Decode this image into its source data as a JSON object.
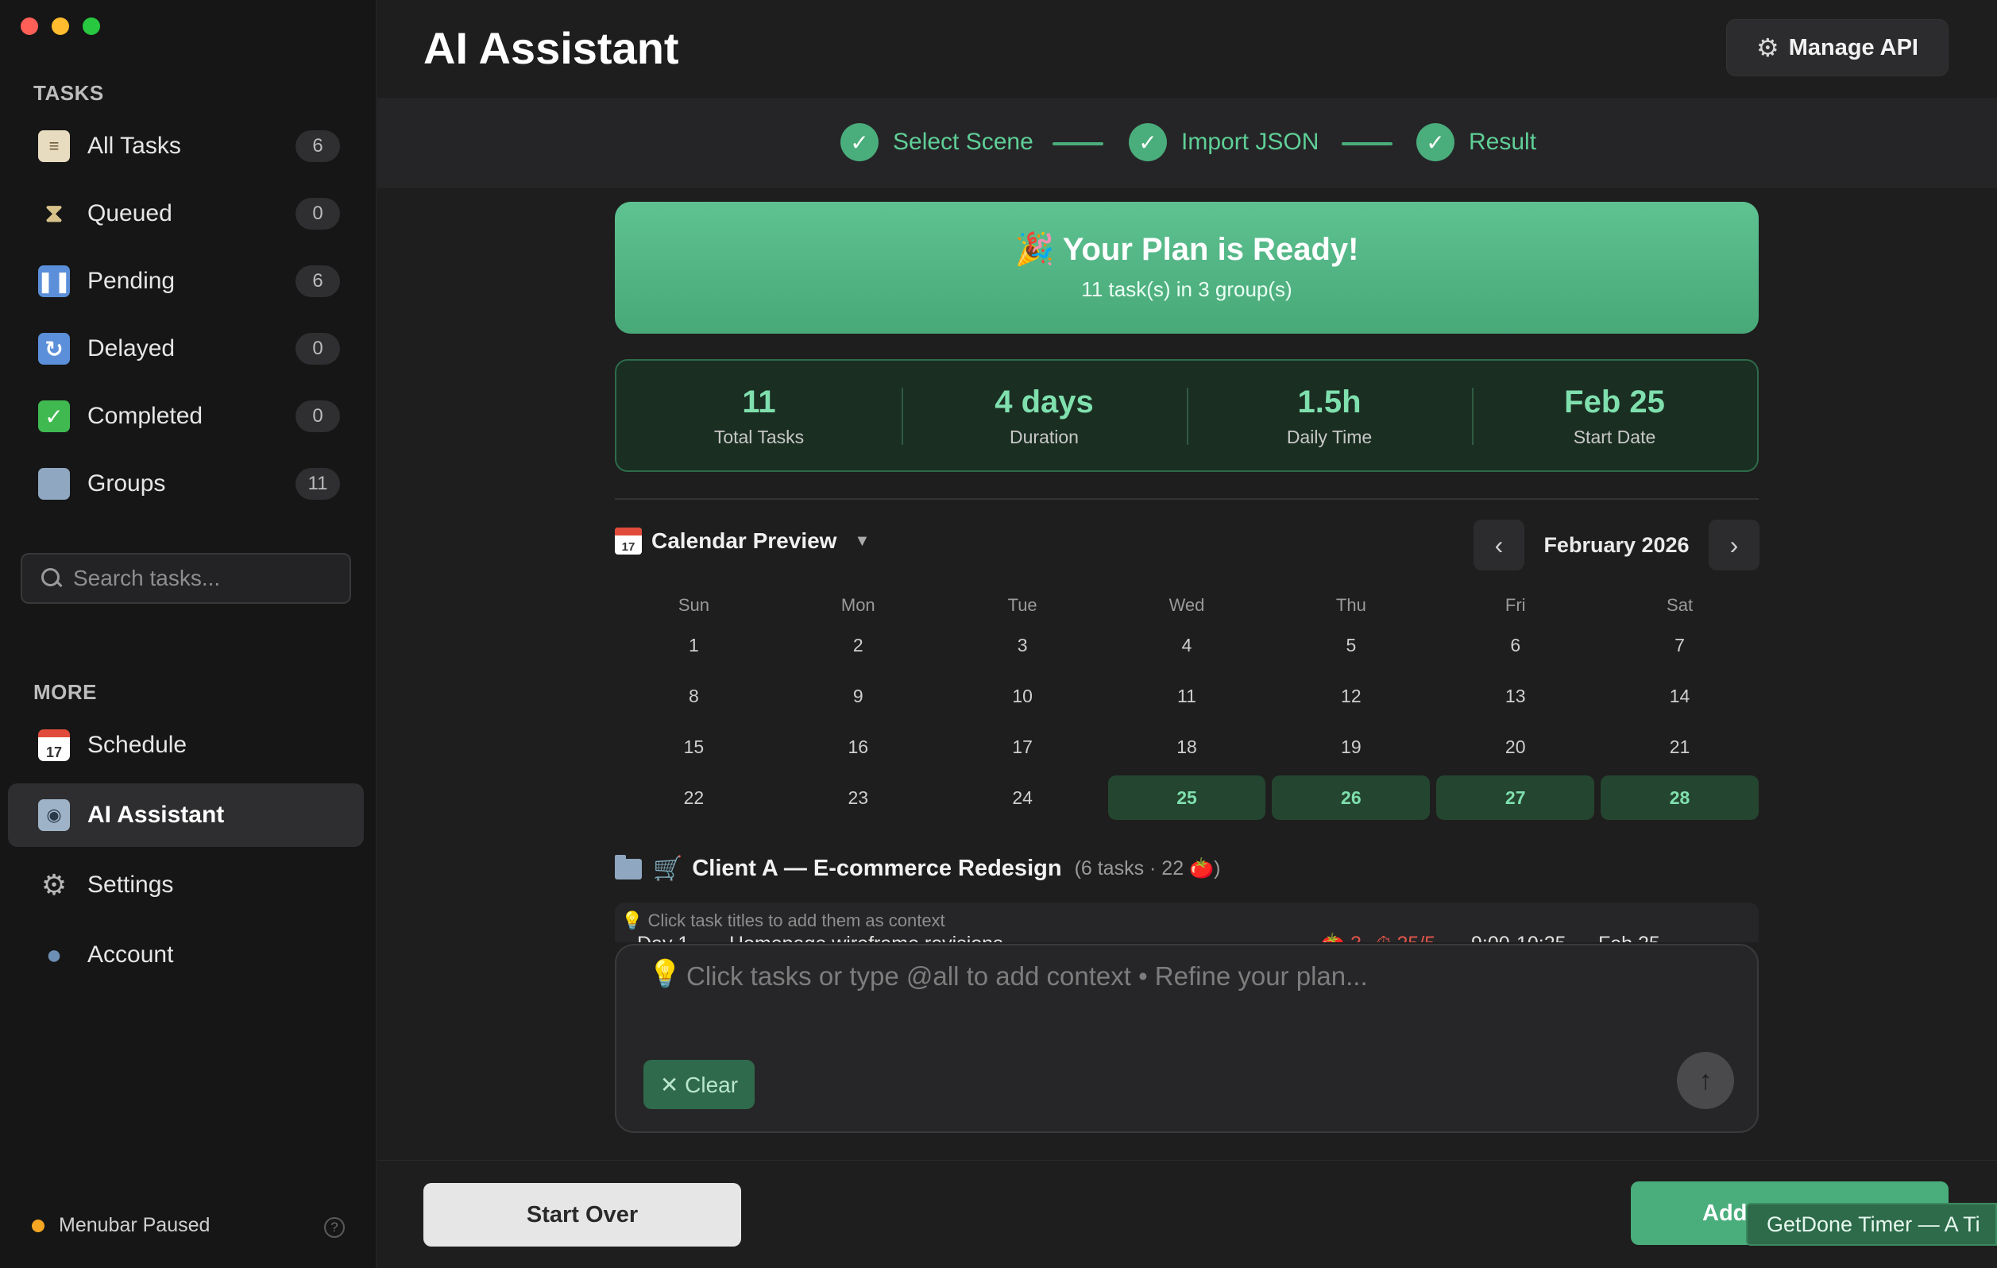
{
  "sidebar": {
    "tasks_label": "TASKS",
    "items": [
      {
        "label": "All Tasks",
        "count": "6",
        "icon": "clipboard-icon"
      },
      {
        "label": "Queued",
        "count": "0",
        "icon": "hourglass-icon"
      },
      {
        "label": "Pending",
        "count": "6",
        "icon": "pause-icon"
      },
      {
        "label": "Delayed",
        "count": "0",
        "icon": "refresh-icon"
      },
      {
        "label": "Completed",
        "count": "0",
        "icon": "checkmark-icon"
      },
      {
        "label": "Groups",
        "count": "11",
        "icon": "folder-icon"
      }
    ],
    "search_placeholder": "Search tasks...",
    "more_label": "MORE",
    "more_items": [
      {
        "label": "Schedule",
        "icon": "calendar-icon"
      },
      {
        "label": "AI Assistant",
        "icon": "robot-icon",
        "active": true
      },
      {
        "label": "Settings",
        "icon": "gear-icon"
      },
      {
        "label": "Account",
        "icon": "user-icon"
      }
    ],
    "status": "Menubar Paused",
    "help": "?"
  },
  "header": {
    "title": "AI Assistant",
    "manage_api": "Manage API"
  },
  "steps": [
    {
      "label": "Select Scene",
      "done": true
    },
    {
      "label": "Import JSON",
      "done": true
    },
    {
      "label": "Result",
      "done": true
    }
  ],
  "banner": {
    "title": "🎉 Your Plan is Ready!",
    "subtitle": "11 task(s) in 3 group(s)"
  },
  "stats": [
    {
      "value": "11",
      "label": "Total Tasks"
    },
    {
      "value": "4 days",
      "label": "Duration"
    },
    {
      "value": "1.5h",
      "label": "Daily Time"
    },
    {
      "value": "Feb 25",
      "label": "Start Date"
    }
  ],
  "calendar": {
    "title": "Calendar Preview",
    "icon_day": "17",
    "month": "February 2026",
    "weekdays": [
      "Sun",
      "Mon",
      "Tue",
      "Wed",
      "Thu",
      "Fri",
      "Sat"
    ],
    "weeks": [
      [
        "1",
        "2",
        "3",
        "4",
        "5",
        "6",
        "7"
      ],
      [
        "8",
        "9",
        "10",
        "11",
        "12",
        "13",
        "14"
      ],
      [
        "15",
        "16",
        "17",
        "18",
        "19",
        "20",
        "21"
      ],
      [
        "22",
        "23",
        "24",
        "25",
        "26",
        "27",
        "28"
      ]
    ],
    "highlighted": [
      "25",
      "26",
      "27",
      "28"
    ]
  },
  "group": {
    "title": "Client A — E-commerce Redesign",
    "meta": "(6 tasks · 22 🍅)"
  },
  "tasks": {
    "hint": "💡 Click task titles to add them as context",
    "first_row": {
      "day": "Day 1",
      "title": "Homepage wireframe revisions",
      "pomodoros": "🍅 3",
      "progress": "⏱ 25/5",
      "time": "9:00-10:25",
      "date": "Feb 25"
    }
  },
  "chat": {
    "placeholder": "Click tasks or type @all to add context • Refine your plan...",
    "clear": "✕ Clear"
  },
  "footer": {
    "start_over": "Start Over",
    "add": "Add"
  },
  "tooltip": "GetDone Timer — A Ti",
  "colors": {
    "accent": "#4aad7c",
    "accent_text": "#7fe0ae",
    "status_dot": "#f5a623",
    "sidebar_bg": "#161616",
    "main_bg": "#1e1e1e"
  }
}
